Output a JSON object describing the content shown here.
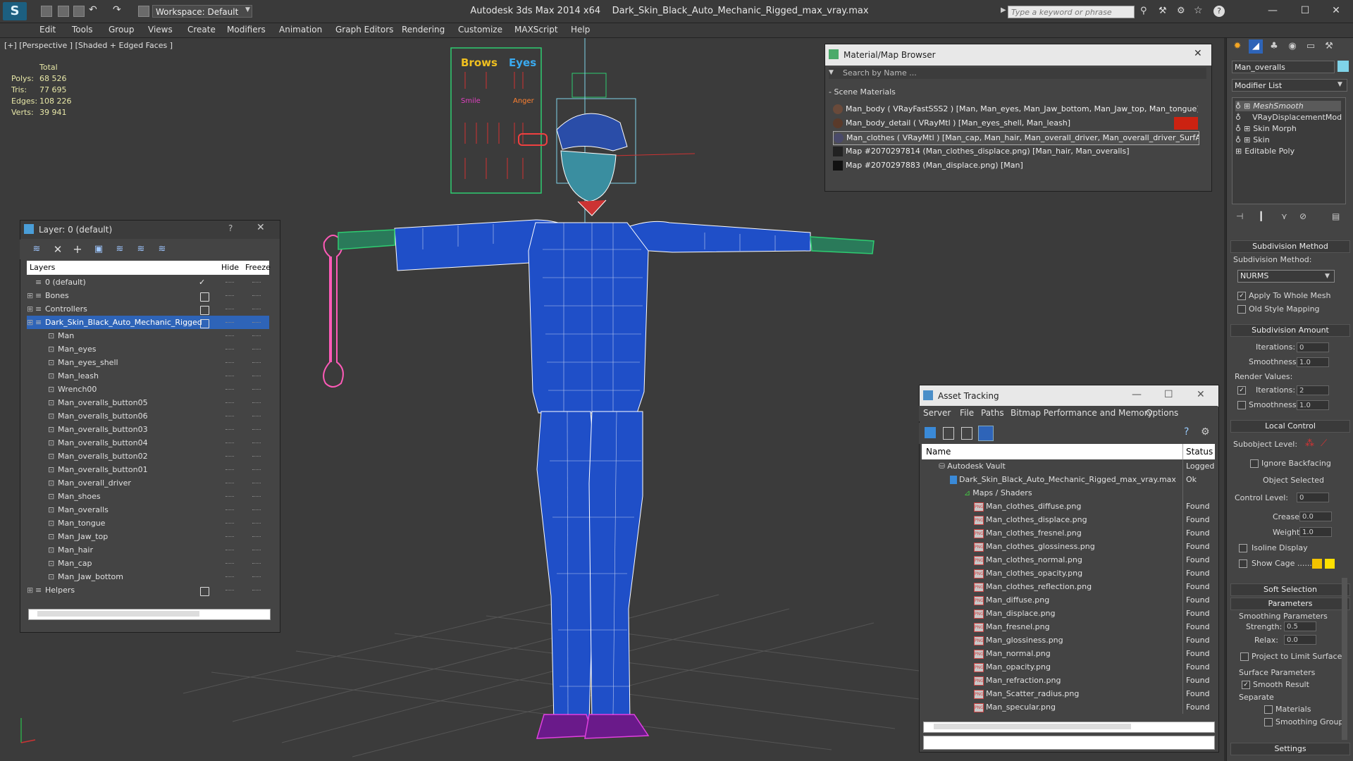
{
  "titlebar": {
    "app_title": "Autodesk 3ds Max  2014 x64",
    "file_name": "Dark_Skin_Black_Auto_Mechanic_Rigged_max_vray.max",
    "workspace": "Workspace: Default",
    "search_placeholder": "Type a keyword or phrase"
  },
  "menu": [
    "Edit",
    "Tools",
    "Group",
    "Views",
    "Create",
    "Modifiers",
    "Animation",
    "Graph Editors",
    "Rendering",
    "Customize",
    "MAXScript",
    "Help"
  ],
  "viewport": {
    "label": "[+] [Perspective ] [Shaded + Edged Faces ]",
    "stats_title": "Total",
    "stats": [
      {
        "label": "Polys:",
        "value": "68 526"
      },
      {
        "label": "Tris:",
        "value": "77 695"
      },
      {
        "label": "Edges:",
        "value": "108 226"
      },
      {
        "label": "Verts:",
        "value": "39 941"
      }
    ],
    "rig_labels": {
      "brows": "Brows",
      "eyes": "Eyes",
      "smile": "Smile",
      "anger": "Anger"
    }
  },
  "layer_panel": {
    "title": "Layer: 0 (default)",
    "help": "?",
    "col_layers": "Layers",
    "col_hide": "Hide",
    "col_freeze": "Freeze",
    "rows": [
      {
        "name": "0 (default)",
        "indent": 0
      },
      {
        "name": "Bones",
        "indent": 0
      },
      {
        "name": "Controllers",
        "indent": 0
      },
      {
        "name": "Dark_Skin_Black_Auto_Mechanic_Rigged",
        "indent": 0,
        "selected": true
      },
      {
        "name": "Man",
        "indent": 1
      },
      {
        "name": "Man_eyes",
        "indent": 1
      },
      {
        "name": "Man_eyes_shell",
        "indent": 1
      },
      {
        "name": "Man_leash",
        "indent": 1
      },
      {
        "name": "Wrench00",
        "indent": 1
      },
      {
        "name": "Man_overalls_button05",
        "indent": 1
      },
      {
        "name": "Man_overalls_button06",
        "indent": 1
      },
      {
        "name": "Man_overalls_button03",
        "indent": 1
      },
      {
        "name": "Man_overalls_button04",
        "indent": 1
      },
      {
        "name": "Man_overalls_button02",
        "indent": 1
      },
      {
        "name": "Man_overalls_button01",
        "indent": 1
      },
      {
        "name": "Man_overall_driver",
        "indent": 1
      },
      {
        "name": "Man_shoes",
        "indent": 1
      },
      {
        "name": "Man_overalls",
        "indent": 1
      },
      {
        "name": "Man_tongue",
        "indent": 1
      },
      {
        "name": "Man_Jaw_top",
        "indent": 1
      },
      {
        "name": "Man_hair",
        "indent": 1
      },
      {
        "name": "Man_cap",
        "indent": 1
      },
      {
        "name": "Man_Jaw_bottom",
        "indent": 1
      },
      {
        "name": "Helpers",
        "indent": 0
      }
    ]
  },
  "material_browser": {
    "title": "Material/Map Browser",
    "search_placeholder": "Search by Name ...",
    "section": "- Scene Materials",
    "items": [
      "Man_body  ( VRayFastSSS2 ) [Man, Man_eyes, Man_Jaw_bottom, Man_Jaw_top, Man_tongue]",
      "Man_body_detail  ( VRayMtl ) [Man_eyes_shell, Man_leash]",
      "Man_clothes  ( VRayMtl ) [Man_cap, Man_hair, Man_overall_driver, Man_overall_driver_SurfAt...",
      "Map #2070297814 (Man_clothes_displace.png) [Man_hair, Man_overalls]",
      "Map #2070297883 (Man_displace.png) [Man]"
    ]
  },
  "asset_tracking": {
    "title": "Asset Tracking",
    "menu": [
      "Server",
      "File",
      "Paths",
      "Bitmap Performance and Memory",
      "Options"
    ],
    "col_name": "Name",
    "col_status": "Status",
    "rows": [
      {
        "name": "Autodesk Vault",
        "status": "Logged C",
        "level": 0,
        "kind": "vault"
      },
      {
        "name": "Dark_Skin_Black_Auto_Mechanic_Rigged_max_vray.max",
        "status": "Ok",
        "level": 1,
        "kind": "max"
      },
      {
        "name": "Maps / Shaders",
        "status": "",
        "level": 2,
        "kind": "folder"
      },
      {
        "name": "Man_clothes_diffuse.png",
        "status": "Found",
        "level": 3,
        "kind": "png"
      },
      {
        "name": "Man_clothes_displace.png",
        "status": "Found",
        "level": 3,
        "kind": "png"
      },
      {
        "name": "Man_clothes_fresnel.png",
        "status": "Found",
        "level": 3,
        "kind": "png"
      },
      {
        "name": "Man_clothes_glossiness.png",
        "status": "Found",
        "level": 3,
        "kind": "png"
      },
      {
        "name": "Man_clothes_normal.png",
        "status": "Found",
        "level": 3,
        "kind": "png"
      },
      {
        "name": "Man_clothes_opacity.png",
        "status": "Found",
        "level": 3,
        "kind": "png"
      },
      {
        "name": "Man_clothes_reflection.png",
        "status": "Found",
        "level": 3,
        "kind": "png"
      },
      {
        "name": "Man_diffuse.png",
        "status": "Found",
        "level": 3,
        "kind": "png"
      },
      {
        "name": "Man_displace.png",
        "status": "Found",
        "level": 3,
        "kind": "png"
      },
      {
        "name": "Man_fresnel.png",
        "status": "Found",
        "level": 3,
        "kind": "png"
      },
      {
        "name": "Man_glossiness.png",
        "status": "Found",
        "level": 3,
        "kind": "png"
      },
      {
        "name": "Man_normal.png",
        "status": "Found",
        "level": 3,
        "kind": "png"
      },
      {
        "name": "Man_opacity.png",
        "status": "Found",
        "level": 3,
        "kind": "png"
      },
      {
        "name": "Man_refraction.png",
        "status": "Found",
        "level": 3,
        "kind": "png"
      },
      {
        "name": "Man_Scatter_radius.png",
        "status": "Found",
        "level": 3,
        "kind": "png"
      },
      {
        "name": "Man_specular.png",
        "status": "Found",
        "level": 3,
        "kind": "png"
      }
    ]
  },
  "command_panel": {
    "object_name": "Man_overalls",
    "object_color": "#7fd3e8",
    "modifier_list": "Modifier List",
    "stack": [
      "MeshSmooth",
      "VRayDisplacementMod",
      "Skin Morph",
      "Skin",
      "Editable Poly"
    ],
    "subdivision_method_header": "Subdivision Method",
    "subdivision_method_label": "Subdivision Method:",
    "subdivision_method_value": "NURMS",
    "apply_whole_mesh": "Apply To Whole Mesh",
    "old_style_mapping": "Old Style Mapping",
    "subdivision_amount_header": "Subdivision Amount",
    "iterations_label": "Iterations:",
    "iterations_value": "0",
    "smoothness_label": "Smoothness:",
    "smoothness_value": "1.0",
    "render_values": "Render Values:",
    "render_iterations_value": "2",
    "render_smoothness_value": "1.0",
    "local_control_header": "Local Control",
    "subobject_level": "Subobject Level:",
    "ignore_backfacing": "Ignore Backfacing",
    "object_selected": "Object Selected",
    "control_level": "Control Level:",
    "control_level_value": "0",
    "crease": "Crease:",
    "crease_value": "0.0",
    "weight": "Weight:",
    "weight_value": "1.0",
    "isoline_display": "Isoline Display",
    "show_cage": "Show Cage ......",
    "cage_color_1": "#f3c300",
    "cage_color_2": "#ffe000",
    "soft_selection_header": "Soft Selection",
    "parameters_header": "Parameters",
    "smoothing_parameters": "Smoothing Parameters",
    "strength": "Strength:",
    "strength_value": "0.5",
    "relax": "Relax:",
    "relax_value": "0.0",
    "project_limit": "Project to Limit Surface",
    "surface_parameters": "Surface Parameters",
    "smooth_result": "Smooth Result",
    "separate": "Separate",
    "materials": "Materials",
    "smoothing_groups": "Smoothing Groups",
    "settings_header": "Settings"
  }
}
